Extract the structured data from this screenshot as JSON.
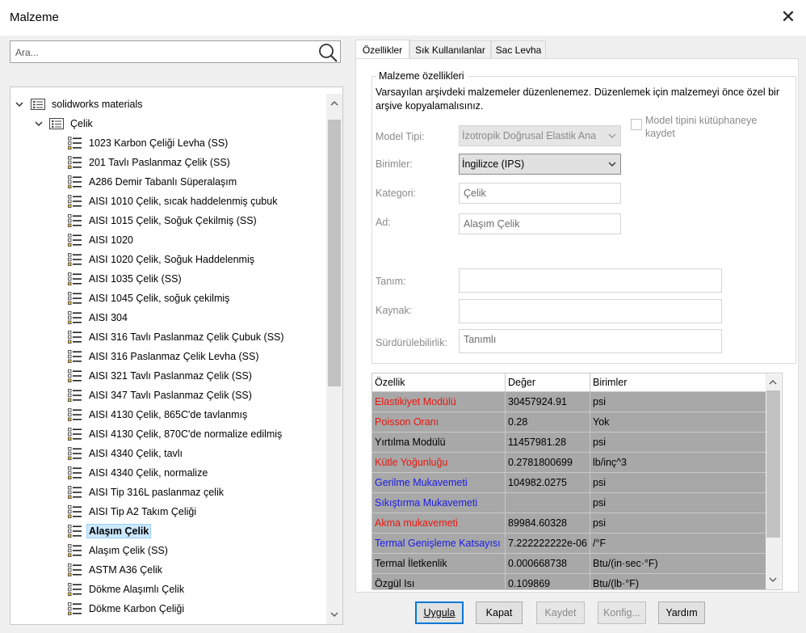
{
  "window": {
    "title": "Malzeme"
  },
  "search": {
    "placeholder": "Ara..."
  },
  "tree": {
    "root": "solidworks materials",
    "folder": "Çelik",
    "items": [
      "1023 Karbon Çeliği Levha (SS)",
      "201 Tavlı Paslanmaz Çelik (SS)",
      "A286 Demir Tabanlı Süperalaşım",
      "AISI 1010 Çelik, sıcak haddelenmiş çubuk",
      "AISI 1015 Çelik, Soğuk Çekilmiş (SS)",
      "AISI 1020",
      "AISI 1020 Çelik, Soğuk Haddelenmiş",
      "AISI 1035 Çelik (SS)",
      "AISI 1045 Çelik, soğuk çekilmiş",
      "AISI 304",
      "AISI 316 Tavlı Paslanmaz Çelik Çubuk (SS)",
      "AISI 316 Paslanmaz Çelik Levha (SS)",
      "AISI 321 Tavlı Paslanmaz Çelik (SS)",
      "AISI 347 Tavlı Paslanmaz Çelik (SS)",
      "AISI 4130 Çelik, 865C'de tavlanmış",
      "AISI 4130 Çelik, 870C'de normalize edilmiş",
      "AISI 4340 Çelik, tavlı",
      "AISI 4340 Çelik, normalize",
      "AISI Tip 316L paslanmaz çelik",
      "AISI Tip A2 Takım Çeliği",
      "Alaşım Çelik",
      "Alaşım Çelik (SS)",
      "ASTM A36 Çelik",
      "Dökme Alaşımlı Çelik",
      "Dökme Karbon Çeliği"
    ],
    "selected_item": "Alaşım Çelik"
  },
  "tabs": [
    "Özellikler",
    "Sık Kullanılanlar",
    "Sac Levha"
  ],
  "props": {
    "group_title": "Malzeme özellikleri",
    "notice": "Varsayılan arşivdeki malzemeler düzenlenemez. Düzenlemek için malzemeyi önce özel bir arşive kopyalamalısınız.",
    "model_label": "Model Tipi:",
    "model_value": "İzotropik Doğrusal Elastik Ana",
    "unit_label": "Birimler:",
    "unit_value": "İngilizce (IPS)",
    "category_label": "Kategori:",
    "category_value": "Çelik",
    "name_label": "Ad:",
    "name_value": "Alaşım Çelik",
    "desc_label": "Tanım:",
    "desc_value": "",
    "source_label": "Kaynak:",
    "source_value": "",
    "sustain_label": "Sürdürülebilirlik:",
    "sustain_value": "Tanımlı",
    "save_type_label": "Model tipini kütüphaneye kaydet"
  },
  "grid": {
    "headers": [
      "Özellik",
      "Değer",
      "Birimler"
    ],
    "rows": [
      {
        "name": "Elastikiyet Modülü",
        "value": "30457924.91",
        "unit": "psi",
        "color": "#e8170e"
      },
      {
        "name": "Poisson Oranı",
        "value": "0.28",
        "unit": "Yok",
        "color": "#e8170e"
      },
      {
        "name": "Yırtılma Modülü",
        "value": "11457981.28",
        "unit": "psi",
        "color": "#000000"
      },
      {
        "name": "Kütle Yoğunluğu",
        "value": "0.2781800699",
        "unit": "lb/inç^3",
        "color": "#e8170e"
      },
      {
        "name": "Gerilme Mukavemeti",
        "value": "104982.0275",
        "unit": "psi",
        "color": "#1a1ae6"
      },
      {
        "name": "Sıkıştırma Mukavemeti",
        "value": "",
        "unit": "psi",
        "color": "#1a1ae6"
      },
      {
        "name": "Akma mukavemeti",
        "value": "89984.60328",
        "unit": "psi",
        "color": "#e8170e"
      },
      {
        "name": "Termal Genişleme Katsayısı",
        "value": "7.222222222e-06",
        "unit": "/°F",
        "color": "#1a1ae6"
      },
      {
        "name": "Termal İletkenlik",
        "value": "0.000668738",
        "unit": "Btu/(in·sec·°F)",
        "color": "#000000"
      },
      {
        "name": "Özgül Isı",
        "value": "0.109869",
        "unit": "Btu/(lb·°F)",
        "color": "#000000"
      }
    ]
  },
  "buttons": {
    "apply": "Uygula",
    "close": "Kapat",
    "save": "Kaydet",
    "config": "Konfig...",
    "help": "Yardım"
  },
  "colors": {
    "selection_bg": "#cce8ff",
    "default_button_border": "#0078d7",
    "required_red": "#e8170e",
    "optional_blue": "#1a1ae6"
  }
}
